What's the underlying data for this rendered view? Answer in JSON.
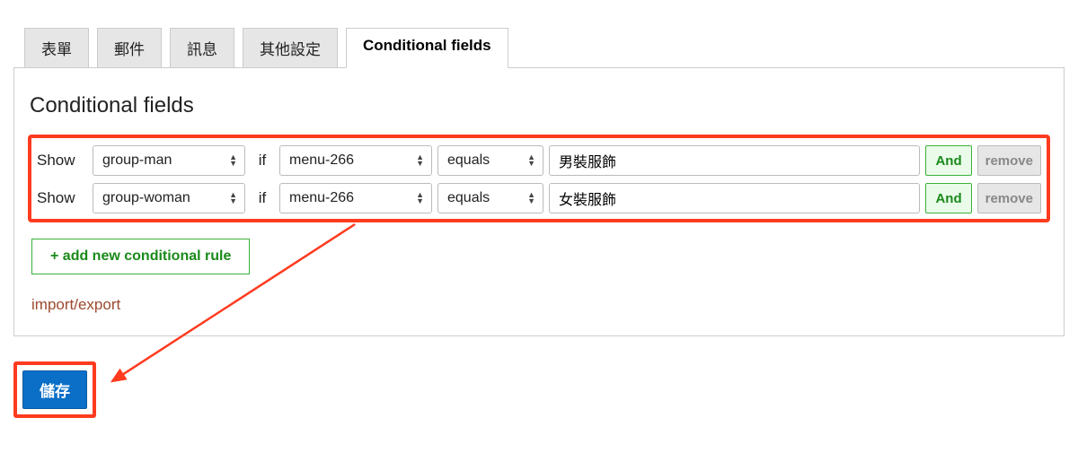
{
  "tabs": [
    {
      "label": "表單",
      "active": false
    },
    {
      "label": "郵件",
      "active": false
    },
    {
      "label": "訊息",
      "active": false
    },
    {
      "label": "其他設定",
      "active": false
    },
    {
      "label": "Conditional fields",
      "active": true
    }
  ],
  "panel": {
    "title": "Conditional fields",
    "rules": [
      {
        "show_label": "Show",
        "group": "group-man",
        "if_label": "if",
        "field": "menu-266",
        "operator": "equals",
        "value": "男裝服飾",
        "and_label": "And",
        "remove_label": "remove"
      },
      {
        "show_label": "Show",
        "group": "group-woman",
        "if_label": "if",
        "field": "menu-266",
        "operator": "equals",
        "value": "女裝服飾",
        "and_label": "And",
        "remove_label": "remove"
      }
    ],
    "add_rule_label": "+ add new conditional rule",
    "import_export_label": "import/export"
  },
  "save_label": "儲存"
}
